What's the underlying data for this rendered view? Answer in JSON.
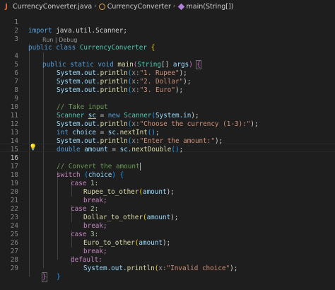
{
  "breadcrumb": {
    "file": "CurrencyConverter.java",
    "class_name": "CurrencyConverter",
    "method": "main(String[])"
  },
  "codelens": {
    "run": "Run",
    "separator": "|",
    "debug": "Debug"
  },
  "line_numbers": [
    "1",
    "2",
    "3",
    "4",
    "5",
    "6",
    "7",
    "8",
    "9",
    "10",
    "11",
    "12",
    "13",
    "14",
    "15",
    "16",
    "17",
    "18",
    "19",
    "20",
    "21",
    "22",
    "23",
    "24",
    "25",
    "26",
    "27",
    "28",
    "29"
  ],
  "active_line": "16",
  "code": {
    "l1_import": "import",
    "l1_pkg": "java.util.Scanner",
    "l1_semi": ";",
    "l3_public": "public",
    "l3_class": "class",
    "l3_name": "CurrencyConverter",
    "l3_brace": "{",
    "l4_public": "public",
    "l4_static": "static",
    "l4_void": "void",
    "l4_main": "main",
    "l4_params_type": "String",
    "l4_params_arr": "[]",
    "l4_params_name": "args",
    "l4_brace": "{",
    "print1_prefix": "System.out.",
    "println": "println",
    "hint_x": "x:",
    "print1_str": "\"1. Rupee\"",
    "print2_str": "\"2. Dollar\"",
    "print3_str": "\"3. Euro\"",
    "close_paren_semi": ");",
    "cmt_take_input": "// Take input",
    "l10_type": "Scanner",
    "l10_var": "sc",
    "l10_eq": " = ",
    "l10_new": "new",
    "l10_ctor": "Scanner",
    "l10_arg": "System.in",
    "l11_str": "\"Choose the currency (1-3):\"",
    "l12_int": "int",
    "l12_var": "choice",
    "l12_rest": "sc.",
    "l12_fn": "nextInt",
    "l13_str": "\"Enter the amount:\"",
    "l14_double": "double",
    "l14_var": "amount",
    "l14_rest": "sc.",
    "l14_fn": "nextDouble",
    "cmt_convert": "// Convert the amount",
    "switch_kw": "switch",
    "switch_var": "choice",
    "case": "case",
    "case1": "1:",
    "case2": "2:",
    "case3": "3:",
    "rupee_fn": "Rupee_to_other",
    "dollar_fn": "Dollar_to_other",
    "euro_fn": "Euro_to_other",
    "amount_arg": "amount",
    "break": "break;",
    "default": "default:",
    "invalid_str": "\"Invalid choice\"",
    "close_brace": "}"
  }
}
